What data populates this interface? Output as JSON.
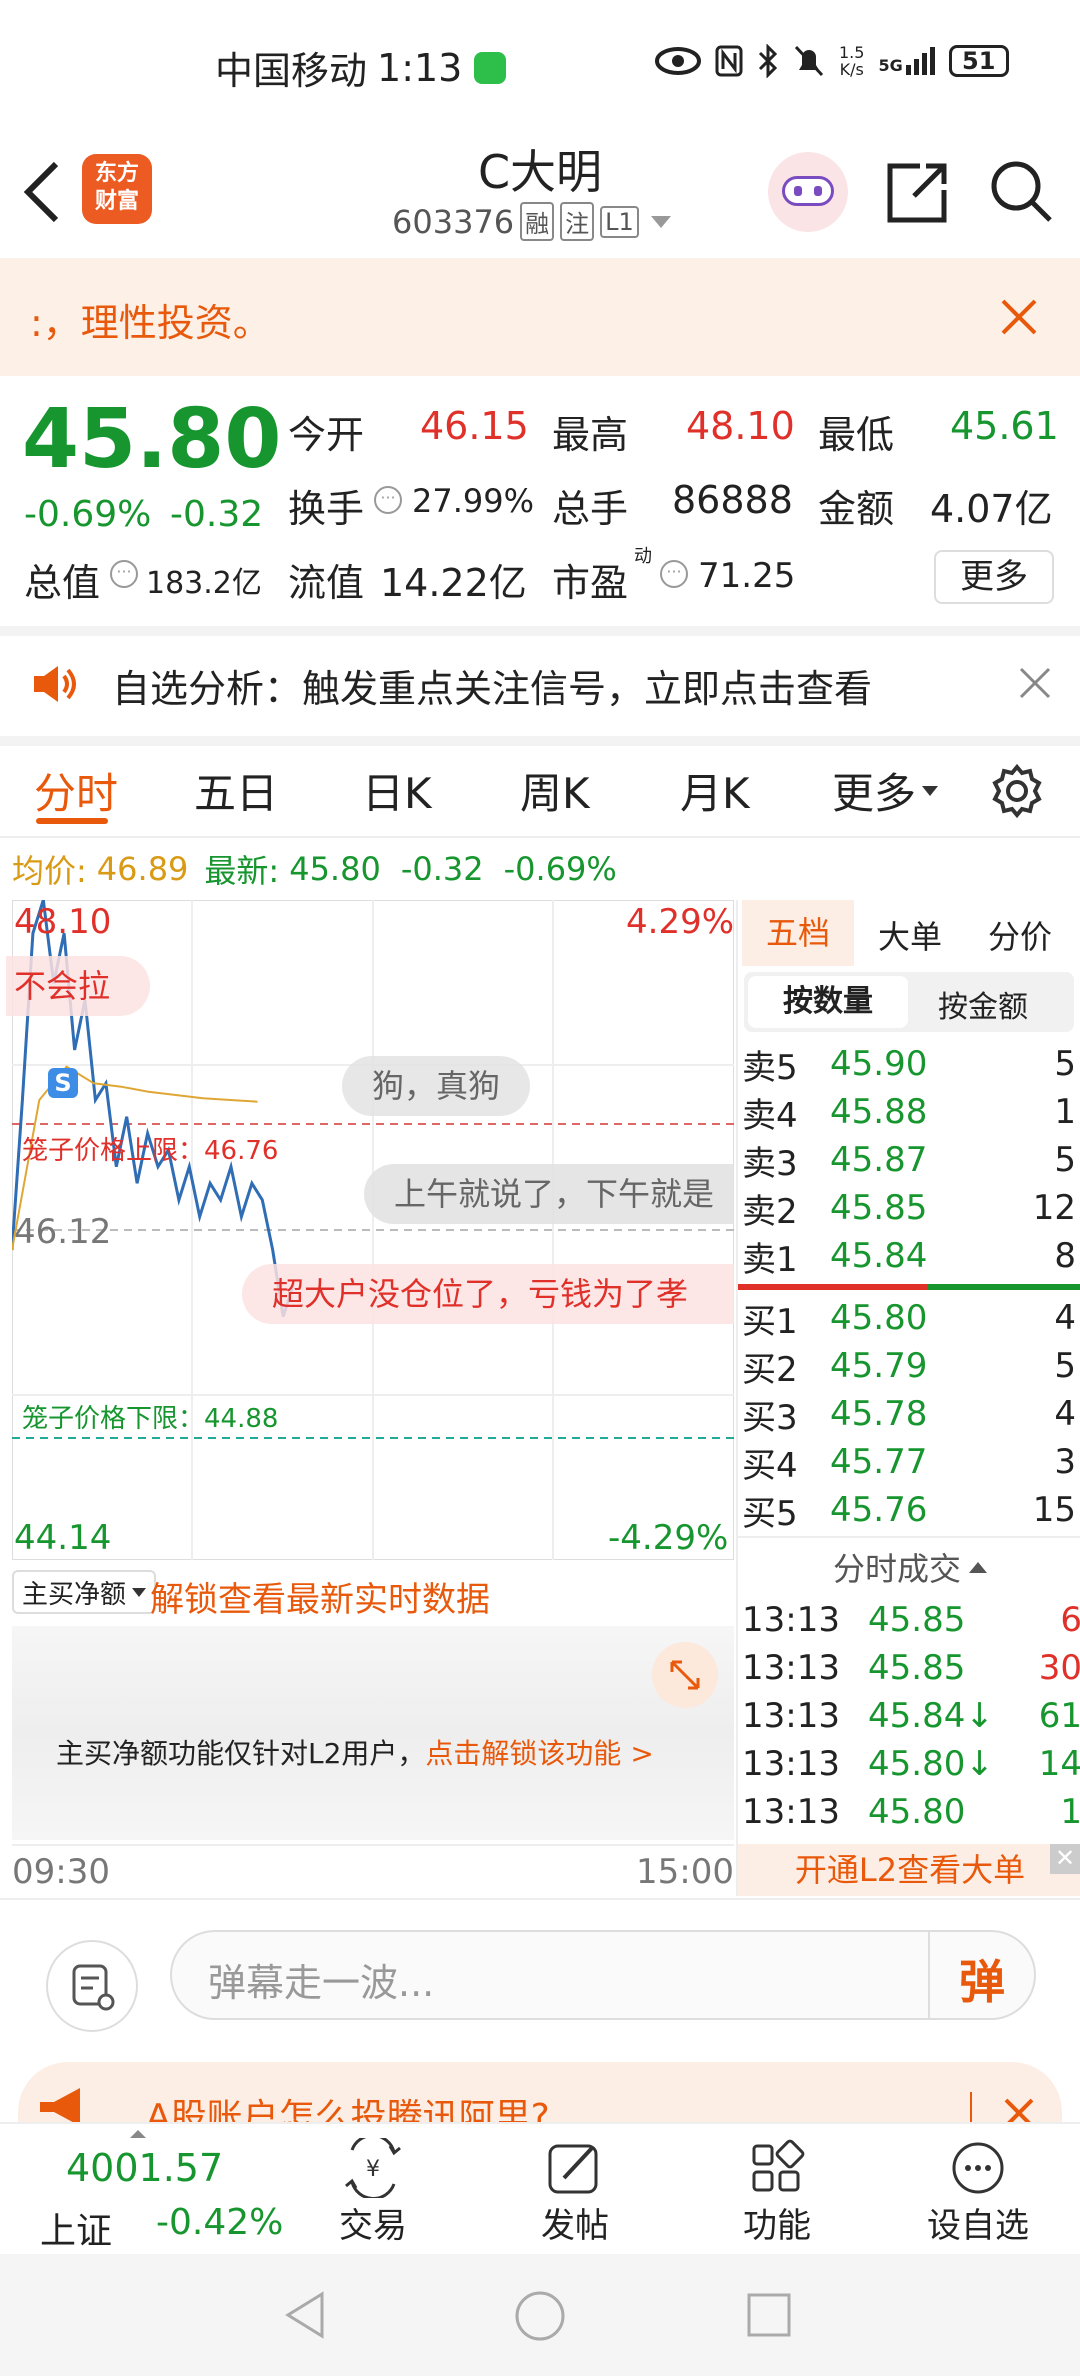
{
  "status_bar": {
    "carrier": "中国移动",
    "time": "1:13",
    "net_speed_top": "1.5",
    "net_speed_bottom": "K/s",
    "net_type": "5G",
    "battery": "51"
  },
  "header": {
    "logo_line1": "东方",
    "logo_line2": "财富",
    "stock_name": "C大明",
    "stock_code": "603376",
    "tags": [
      "融",
      "注",
      "L1"
    ]
  },
  "banner": {
    "text": ":，理性投资。"
  },
  "quote": {
    "price": "45.80",
    "change_pct": "-0.69%",
    "change": "-0.32",
    "open_label": "今开",
    "open": "46.15",
    "high_label": "最高",
    "high": "48.10",
    "low_label": "最低",
    "low": "45.61",
    "turnover_label": "换手",
    "turnover": "27.99%",
    "volume_label": "总手",
    "volume": "86888",
    "amount_label": "金额",
    "amount": "4.07亿",
    "mktcap_label": "总值",
    "mktcap": "183.2亿",
    "float_label": "流值",
    "float": "14.22亿",
    "pe_label": "市盈",
    "pe_sup": "动",
    "pe": "71.25",
    "more_label": "更多"
  },
  "notice": {
    "text": "自选分析：触发重点关注信号，立即点击查看"
  },
  "tabs": [
    "分时",
    "五日",
    "日K",
    "周K",
    "月K",
    "更多"
  ],
  "chart_header": {
    "avg_label": "均价:",
    "avg": "46.89",
    "last_label": "最新:",
    "last": "45.80",
    "change": "-0.32",
    "change_pct": "-0.69%"
  },
  "chart_labels": {
    "top_price": "48.10",
    "top_pct": "4.29%",
    "mid_price": "46.12",
    "bottom_price": "44.14",
    "bottom_pct": "-4.29%",
    "cage_upper": "笼子价格上限：46.76",
    "cage_lower": "笼子价格下限：44.88",
    "time_start": "09:30",
    "time_end": "15:00"
  },
  "danmaku": [
    "不会拉",
    "狗，真狗",
    "上午就说了，下午就是",
    "超大户没仓位了，亏钱为了孝"
  ],
  "chart_data": {
    "type": "line",
    "ylim": [
      44.14,
      48.1
    ],
    "x": [
      "09:30",
      "15:00"
    ],
    "series": [
      {
        "name": "最新",
        "values": [
          46.0,
          46.9,
          47.9,
          48.1,
          47.6,
          47.9,
          47.2,
          47.5,
          46.9,
          47.0,
          46.5,
          46.8,
          46.4,
          46.7,
          46.5,
          46.6,
          46.3,
          46.5,
          46.2,
          46.4,
          46.3,
          46.5,
          46.2,
          46.4,
          46.3,
          46.0,
          45.6,
          45.8
        ]
      },
      {
        "name": "均价",
        "values": [
          46.0,
          46.9,
          47.1,
          47.0,
          46.98,
          46.95,
          46.93,
          46.91,
          46.9,
          46.89
        ]
      }
    ]
  },
  "subchart": {
    "selector": "主买净额",
    "unlock_title": "解锁查看最新实时数据",
    "msg": "主买净额功能仅针对L2用户，",
    "link": "点击解锁该功能 >"
  },
  "orderbook": {
    "tabs": [
      "五档",
      "大单",
      "分价"
    ],
    "subtabs": [
      "按数量",
      "按金额"
    ],
    "sells": [
      {
        "label": "卖5",
        "price": "45.90",
        "qty": "5"
      },
      {
        "label": "卖4",
        "price": "45.88",
        "qty": "1"
      },
      {
        "label": "卖3",
        "price": "45.87",
        "qty": "5"
      },
      {
        "label": "卖2",
        "price": "45.85",
        "qty": "12"
      },
      {
        "label": "卖1",
        "price": "45.84",
        "qty": "8"
      }
    ],
    "buys": [
      {
        "label": "买1",
        "price": "45.80",
        "qty": "4"
      },
      {
        "label": "买2",
        "price": "45.79",
        "qty": "5"
      },
      {
        "label": "买3",
        "price": "45.78",
        "qty": "4"
      },
      {
        "label": "买4",
        "price": "45.77",
        "qty": "3"
      },
      {
        "label": "买5",
        "price": "45.76",
        "qty": "15"
      }
    ],
    "ticks_title": "分时成交",
    "ticks": [
      {
        "time": "13:13",
        "price": "45.85",
        "arrow": "",
        "qty": "6"
      },
      {
        "time": "13:13",
        "price": "45.85",
        "arrow": "",
        "qty": "30"
      },
      {
        "time": "13:13",
        "price": "45.84",
        "arrow": "↓",
        "qty": "61"
      },
      {
        "time": "13:13",
        "price": "45.80",
        "arrow": "↓",
        "qty": "14"
      },
      {
        "time": "13:13",
        "price": "45.80",
        "arrow": "",
        "qty": "1"
      }
    ],
    "l2_cta": "开通L2查看大单"
  },
  "comment": {
    "placeholder": "弹幕走一波...",
    "send_label": "弹"
  },
  "ad": {
    "text": "A股账户怎么投腾讯阿里?"
  },
  "bottom_nav": {
    "index_value": "4001.57",
    "index_name": "上证",
    "index_change": "-0.42%",
    "items": [
      "交易",
      "发帖",
      "功能",
      "设自选"
    ]
  }
}
